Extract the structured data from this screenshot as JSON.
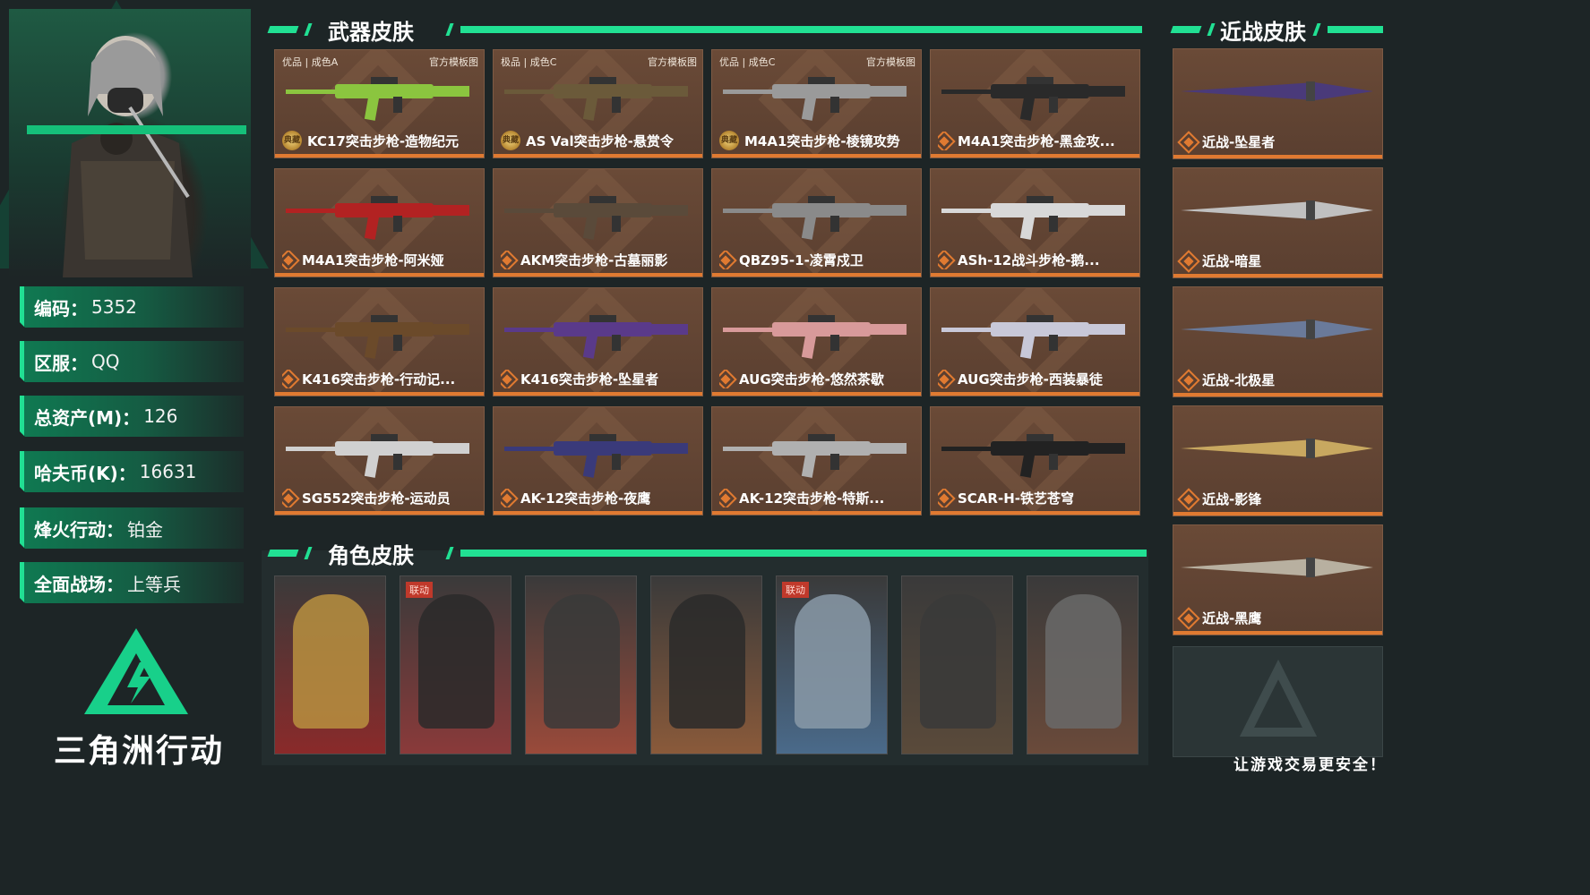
{
  "sections": {
    "weapon_title": "武器皮肤",
    "melee_title": "近战皮肤",
    "character_title": "角色皮肤"
  },
  "stats": [
    {
      "label": "编码：",
      "value": "5352"
    },
    {
      "label": "区服：",
      "value": "QQ"
    },
    {
      "label": "总资产(M)：",
      "value": "126"
    },
    {
      "label": "哈夫币(K)：",
      "value": "16631"
    },
    {
      "label": "烽火行动：",
      "value": "铂金"
    },
    {
      "label": "全面战场：",
      "value": "上等兵"
    }
  ],
  "brand": "三角洲行动",
  "slogan": "让游戏交易更安全！",
  "weapons": [
    {
      "name": "KC17突击步枪-造物纪元",
      "tag_left": "优品 | 成色A",
      "tag_right": "官方模板图",
      "icon": "badge-icon",
      "badge": "典藏",
      "color": "#8bc53f"
    },
    {
      "name": "AS Val突击步枪-悬赏令",
      "tag_left": "极品 | 成色C",
      "tag_right": "官方模板图",
      "icon": "badge-icon",
      "badge": "典藏",
      "color": "#6b5a3a"
    },
    {
      "name": "M4A1突击步枪-棱镜攻势",
      "tag_left": "优品 | 成色C",
      "tag_right": "官方模板图",
      "icon": "badge-icon",
      "badge": "典藏",
      "color": "#9a9a9a"
    },
    {
      "name": "M4A1突击步枪-黑金攻...",
      "tag_left": "",
      "tag_right": "",
      "icon": "diamond-icon",
      "badge": "",
      "color": "#2a2a2a"
    },
    {
      "name": "M4A1突击步枪-阿米娅",
      "tag_left": "",
      "tag_right": "",
      "icon": "diamond-icon",
      "badge": "",
      "color": "#b22222"
    },
    {
      "name": "AKM突击步枪-古墓丽影",
      "tag_left": "",
      "tag_right": "",
      "icon": "diamond-icon",
      "badge": "",
      "color": "#5a4a3a"
    },
    {
      "name": "QBZ95-1-凌霄戍卫",
      "tag_left": "",
      "tag_right": "",
      "icon": "diamond-icon",
      "badge": "",
      "color": "#8a8a8a"
    },
    {
      "name": "ASh-12战斗步枪-鹅...",
      "tag_left": "",
      "tag_right": "",
      "icon": "diamond-icon",
      "badge": "",
      "color": "#d8d8d8"
    },
    {
      "name": "K416突击步枪-行动记...",
      "tag_left": "",
      "tag_right": "",
      "icon": "diamond-icon",
      "badge": "",
      "color": "#6b4a2a"
    },
    {
      "name": "K416突击步枪-坠星者",
      "tag_left": "",
      "tag_right": "",
      "icon": "diamond-icon",
      "badge": "",
      "color": "#5a3a8a"
    },
    {
      "name": "AUG突击步枪-悠然茶歇",
      "tag_left": "",
      "tag_right": "",
      "icon": "diamond-icon",
      "badge": "",
      "color": "#d89a9a"
    },
    {
      "name": "AUG突击步枪-西装暴徒",
      "tag_left": "",
      "tag_right": "",
      "icon": "diamond-icon",
      "badge": "",
      "color": "#c8c8d8"
    },
    {
      "name": "SG552突击步枪-运动员",
      "tag_left": "",
      "tag_right": "",
      "icon": "diamond-icon",
      "badge": "",
      "color": "#d0d0d0"
    },
    {
      "name": "AK-12突击步枪-夜鹰",
      "tag_left": "",
      "tag_right": "",
      "icon": "diamond-icon",
      "badge": "",
      "color": "#3a3a7a"
    },
    {
      "name": "AK-12突击步枪-特斯...",
      "tag_left": "",
      "tag_right": "",
      "icon": "diamond-icon",
      "badge": "",
      "color": "#b0b0b0"
    },
    {
      "name": "SCAR-H-铁艺苍穹",
      "tag_left": "",
      "tag_right": "",
      "icon": "diamond-icon",
      "badge": "",
      "color": "#222222"
    }
  ],
  "melee": [
    {
      "name": "近战-坠星者",
      "color": "#4a3a7a"
    },
    {
      "name": "近战-暗星",
      "color": "#c0c0c0"
    },
    {
      "name": "近战-北极星",
      "color": "#6a7a9a"
    },
    {
      "name": "近战-影锋",
      "color": "#c8a860"
    },
    {
      "name": "近战-黑鹰",
      "color": "#b8b0a0"
    }
  ],
  "characters": [
    {
      "collab": "",
      "bg": "#8a2a2a",
      "fig": "#b89040"
    },
    {
      "collab": "联动",
      "bg": "#8a3a3a",
      "fig": "#2a2a2a"
    },
    {
      "collab": "",
      "bg": "#9a4a3a",
      "fig": "#3a3a3a"
    },
    {
      "collab": "",
      "bg": "#8a5a3a",
      "fig": "#2a2a2a"
    },
    {
      "collab": "联动",
      "bg": "#4a6a8a",
      "fig": "#8a9aa8"
    },
    {
      "collab": "",
      "bg": "#5a4a3a",
      "fig": "#3a3a3a"
    },
    {
      "collab": "",
      "bg": "#6a4a3a",
      "fig": "#6a6a6a"
    }
  ],
  "colors": {
    "accent": "#21e093",
    "card_bottom": "#e07a31",
    "card_bg": "#5a3f30"
  }
}
